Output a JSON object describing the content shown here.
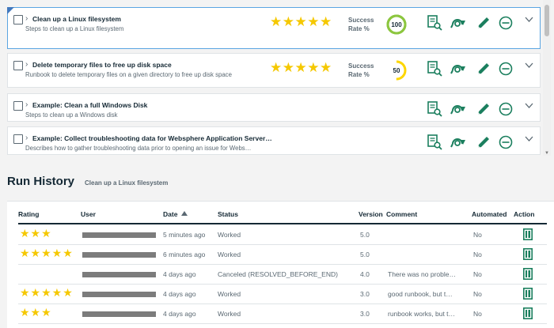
{
  "runbooks": [
    {
      "title": "Clean up a Linux filesystem",
      "description": "Steps to clean up a Linux filesystem",
      "rating": 5,
      "success_label_1": "Success",
      "success_label_2": "Rate %",
      "success_rate": 100,
      "gauge_color": "#8cc63f",
      "selected": true
    },
    {
      "title": "Delete temporary files to free up disk space",
      "description": "Runbook to delete temporary files on a given directory to free up disk space",
      "rating": 5,
      "success_label_1": "Success",
      "success_label_2": "Rate %",
      "success_rate": 50,
      "gauge_color": "#fdd600",
      "selected": false
    },
    {
      "title": "Example: Clean a full Windows Disk",
      "description": "Steps to clean up a Windows disk",
      "rating": 0,
      "success_label_1": "",
      "success_label_2": "",
      "success_rate": null,
      "gauge_color": "",
      "selected": false
    },
    {
      "title": "Example: Collect troubleshooting data for Websphere Application Server…",
      "description": "Describes how to gather troubleshooting data prior to opening an issue for Webs…",
      "rating": 0,
      "success_label_1": "",
      "success_label_2": "",
      "success_rate": null,
      "gauge_color": "",
      "selected": false
    }
  ],
  "icons": {
    "chevron_right": "chevron-right-icon",
    "expand": "chevron-down-icon",
    "preview": "preview-document-icon",
    "execute": "execute-runbook-icon",
    "edit": "pencil-edit-icon",
    "remove": "remove-circle-icon",
    "history_action": "details-document-icon"
  },
  "colors": {
    "icon_green": "#1b7f5e",
    "star": "#f5c800",
    "selected_border": "#5aa5e2",
    "corner": "#4178be"
  },
  "history": {
    "title": "Run History",
    "subtitle": "Clean up a Linux filesystem",
    "headers": {
      "rating": "Rating",
      "user": "User",
      "date": "Date",
      "status": "Status",
      "version": "Version",
      "comment": "Comment",
      "automated": "Automated",
      "action": "Action"
    },
    "sort_column": "date",
    "rows": [
      {
        "rating": 3,
        "date": "5 minutes ago",
        "status": "Worked",
        "version": "5.0",
        "comment": "",
        "automated": "No"
      },
      {
        "rating": 5,
        "date": "6 minutes ago",
        "status": "Worked",
        "version": "5.0",
        "comment": "",
        "automated": "No"
      },
      {
        "rating": 0,
        "date": "4 days ago",
        "status": "Canceled (RESOLVED_BEFORE_END)",
        "version": "4.0",
        "comment": "There was no proble…",
        "automated": "No"
      },
      {
        "rating": 5,
        "date": "4 days ago",
        "status": "Worked",
        "version": "3.0",
        "comment": "good runbook, but t…",
        "automated": "No"
      },
      {
        "rating": 3,
        "date": "4 days ago",
        "status": "Worked",
        "version": "3.0",
        "comment": "runbook works, but t…",
        "automated": "No"
      }
    ]
  }
}
